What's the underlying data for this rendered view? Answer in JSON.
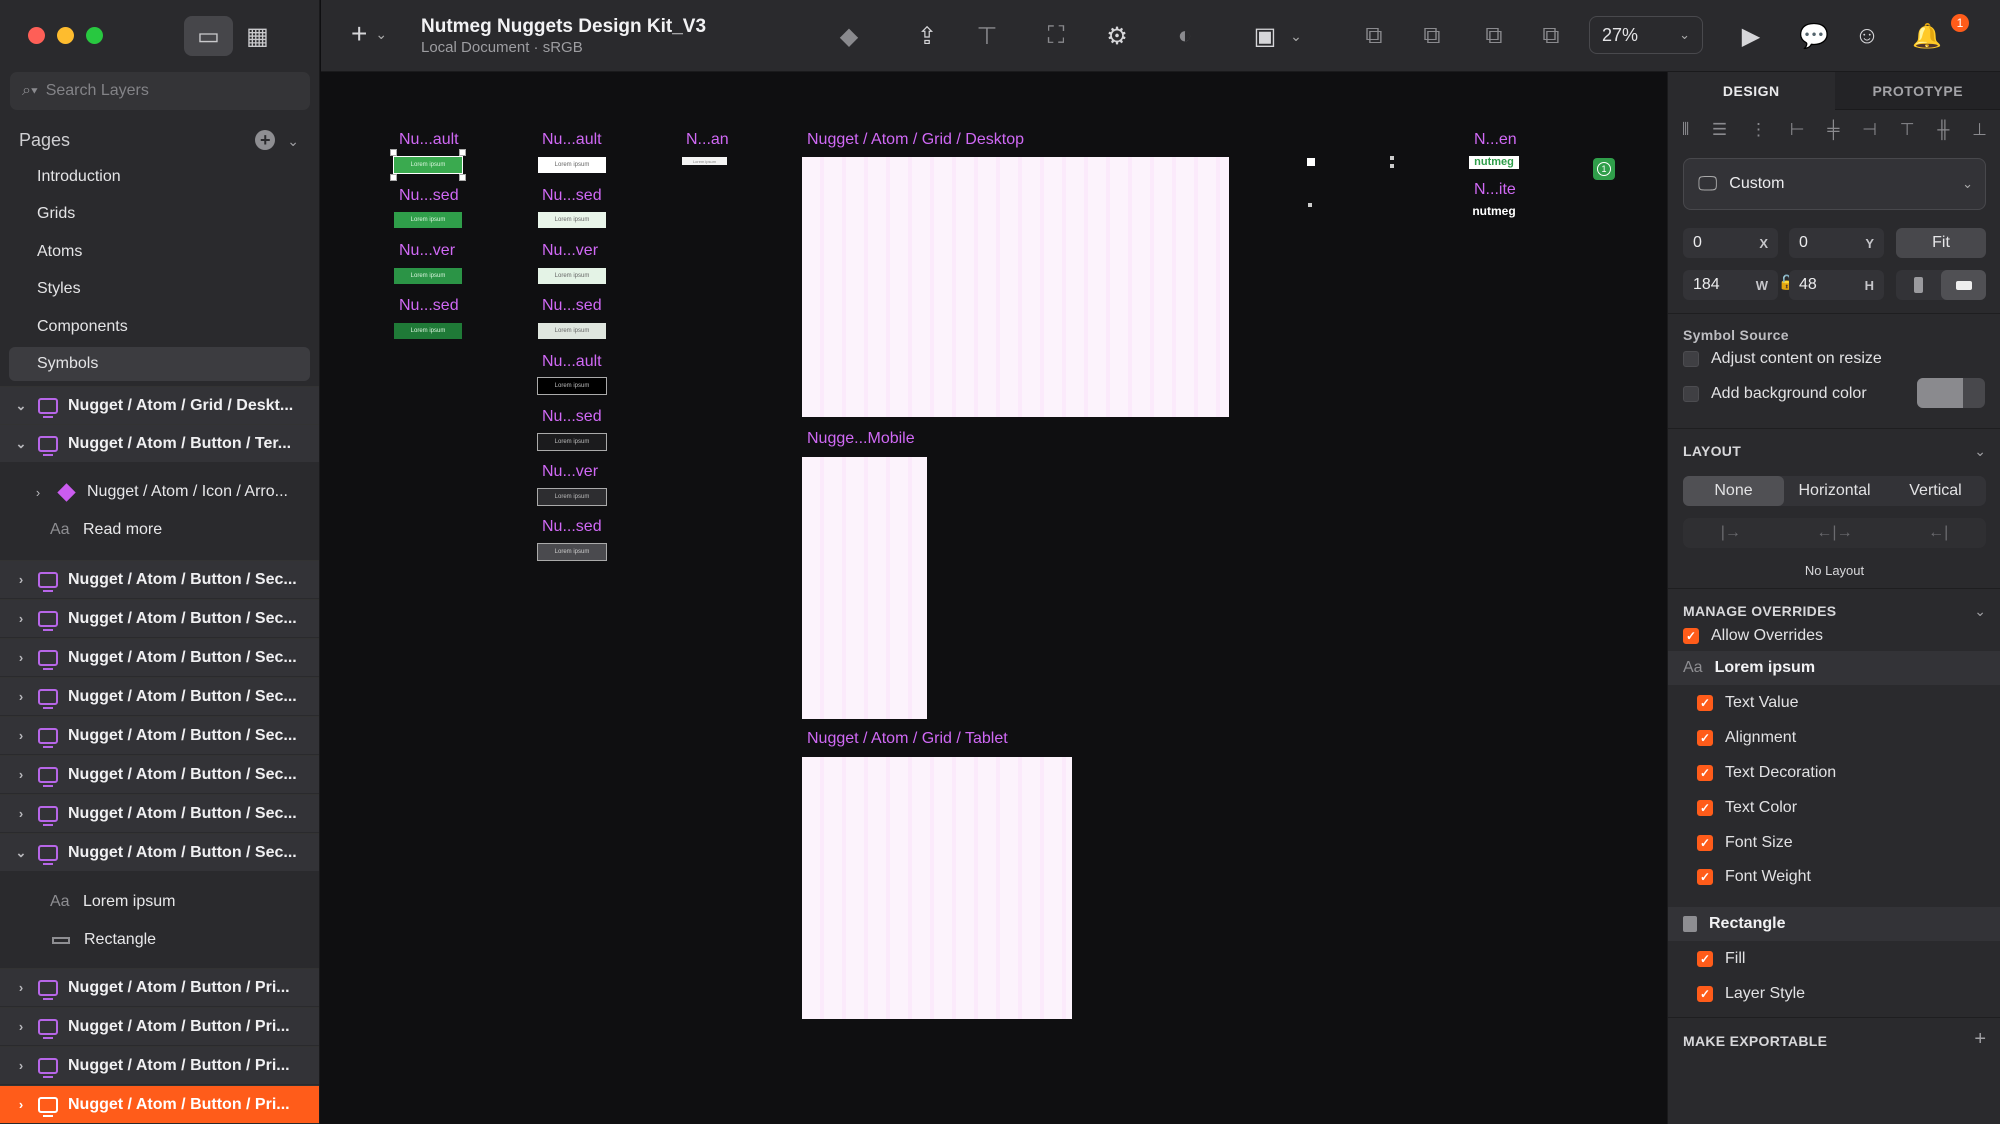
{
  "search_placeholder": "Search Layers",
  "pages_label": "Pages",
  "pages": [
    "Introduction",
    "Grids",
    "Atoms",
    "Styles",
    "Components",
    "Symbols"
  ],
  "layers": {
    "l1": "Nugget / Atom / Grid / Deskt...",
    "l2": "Nugget / Atom / Button / Ter...",
    "sub_icon": "Nugget / Atom / Icon / Arro...",
    "sub_text": "Read more",
    "sec": "Nugget / Atom / Button / Sec...",
    "sub_lorem": "Lorem ipsum",
    "sub_rect": "Rectangle",
    "pri": "Nugget / Atom / Button / Pri..."
  },
  "doc_title": "Nutmeg Nuggets Design Kit_V3",
  "doc_subtitle": "Local Document · sRGB",
  "zoom": "27%",
  "notifications": "1",
  "canvas": {
    "col1": [
      "Nu...ault",
      "Nu...sed",
      "Nu...ver",
      "Nu...sed"
    ],
    "col2": [
      "Nu...ault",
      "Nu...sed",
      "Nu...ver",
      "Nu...sed",
      "Nu...ault",
      "Nu...sed",
      "Nu...ver",
      "Nu...sed"
    ],
    "col3": "N...an",
    "btn_text": "Lorem ipsum",
    "desktop": "Nugget / Atom / Grid / Desktop",
    "mobile": "Nugge...Mobile",
    "tablet": "Nugget / Atom / Grid / Tablet",
    "ne1": "N...en",
    "ne2": "N...ite",
    "brand": "nutmeg",
    "badge": "1"
  },
  "inspector": {
    "tab_design": "DESIGN",
    "tab_proto": "PROTOTYPE",
    "preset": "Custom",
    "x": "0",
    "x_label": "X",
    "y": "0",
    "y_label": "Y",
    "fit": "Fit",
    "w": "184",
    "w_label": "W",
    "h": "48",
    "h_label": "H",
    "symbol_source": "Symbol Source",
    "adjust": "Adjust content on resize",
    "add_bg": "Add background color",
    "layout": "LAYOUT",
    "layout_opts": [
      "None",
      "Horizontal",
      "Vertical"
    ],
    "no_layout": "No Layout",
    "manage": "MANAGE OVERRIDES",
    "allow": "Allow Overrides",
    "grp1": "Lorem ipsum",
    "grp1_items": [
      "Text Value",
      "Alignment",
      "Text Decoration",
      "Text Color",
      "Font Size",
      "Font Weight"
    ],
    "grp2": "Rectangle",
    "grp2_items": [
      "Fill",
      "Layer Style"
    ],
    "export": "MAKE EXPORTABLE"
  },
  "colors": {
    "accent": "#ff5c1a",
    "symbol": "#b766e8",
    "label": "#d069f5",
    "green": "#2f9e4a"
  }
}
